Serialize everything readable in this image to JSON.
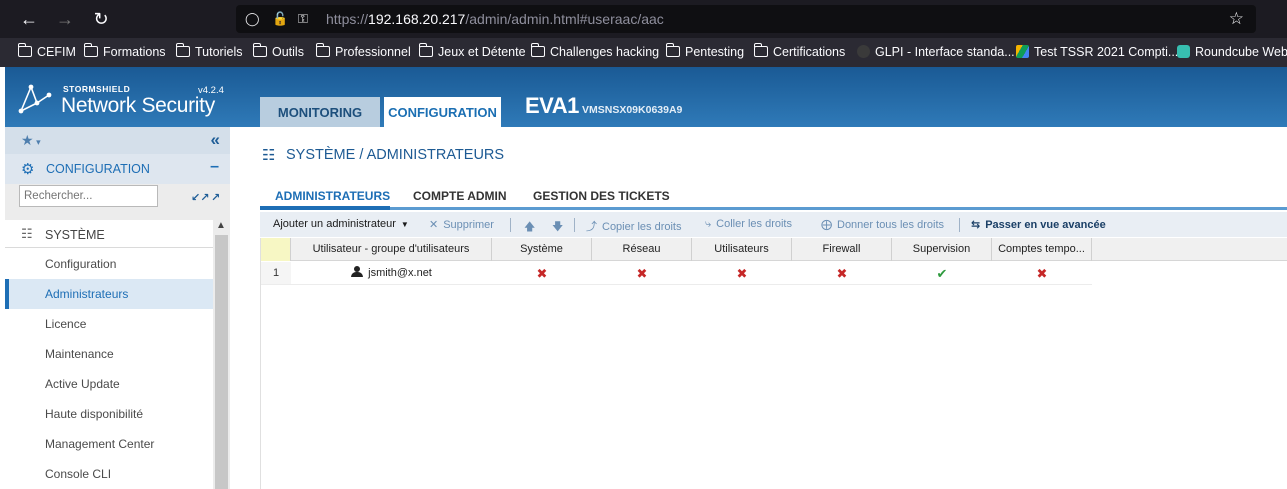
{
  "browser": {
    "url_scheme": "https://",
    "url_host": "192.168.20.217",
    "url_path": "/admin/admin.html#useraac/aac",
    "bookmarks": [
      {
        "label": "CEFIM",
        "type": "folder"
      },
      {
        "label": "Formations",
        "type": "folder"
      },
      {
        "label": "Tutoriels",
        "type": "folder"
      },
      {
        "label": "Outils",
        "type": "folder"
      },
      {
        "label": "Professionnel",
        "type": "folder"
      },
      {
        "label": "Jeux et Détente",
        "type": "folder"
      },
      {
        "label": "Challenges hacking",
        "type": "folder"
      },
      {
        "label": "Pentesting",
        "type": "folder"
      },
      {
        "label": "Certifications",
        "type": "folder"
      },
      {
        "label": "GLPI - Interface standa...",
        "type": "link"
      },
      {
        "label": "Test TSSR 2021 Compti...",
        "type": "link"
      },
      {
        "label": "Roundcube Webm",
        "type": "link"
      }
    ]
  },
  "header": {
    "brand_top": "STORMSHIELD",
    "brand_main": "Network Security",
    "version": "v4.2.4",
    "tabs": [
      {
        "label": "MONITORING"
      },
      {
        "label": "CONFIGURATION"
      }
    ],
    "firewall_name": "EVA1",
    "serial": "VMSNSX09K0639A9"
  },
  "sidebar": {
    "section_label": "CONFIGURATION",
    "search_placeholder": "Rechercher...",
    "tree_head": "SYSTÈME",
    "items": [
      {
        "label": "Configuration"
      },
      {
        "label": "Administrateurs"
      },
      {
        "label": "Licence"
      },
      {
        "label": "Maintenance"
      },
      {
        "label": "Active Update"
      },
      {
        "label": "Haute disponibilité"
      },
      {
        "label": "Management Center"
      },
      {
        "label": "Console CLI"
      }
    ]
  },
  "main": {
    "title": "SYSTÈME / ADMINISTRATEURS",
    "subtabs": [
      {
        "label": "ADMINISTRATEURS"
      },
      {
        "label": "COMPTE ADMIN"
      },
      {
        "label": "GESTION DES TICKETS"
      }
    ],
    "toolbar": {
      "add": "Ajouter un administrateur",
      "delete": "Supprimer",
      "copy": "Copier les droits",
      "paste": "Coller les droits",
      "give_all": "Donner tous les droits",
      "advanced": "Passer en vue avancée"
    },
    "grid": {
      "columns": [
        "Utilisateur - groupe d'utilisateurs",
        "Système",
        "Réseau",
        "Utilisateurs",
        "Firewall",
        "Supervision",
        "Comptes tempo..."
      ],
      "rows": [
        {
          "num": "1",
          "user": "jsmith@x.net",
          "rights": [
            "no",
            "no",
            "no",
            "no",
            "yes",
            "no"
          ]
        }
      ]
    }
  }
}
